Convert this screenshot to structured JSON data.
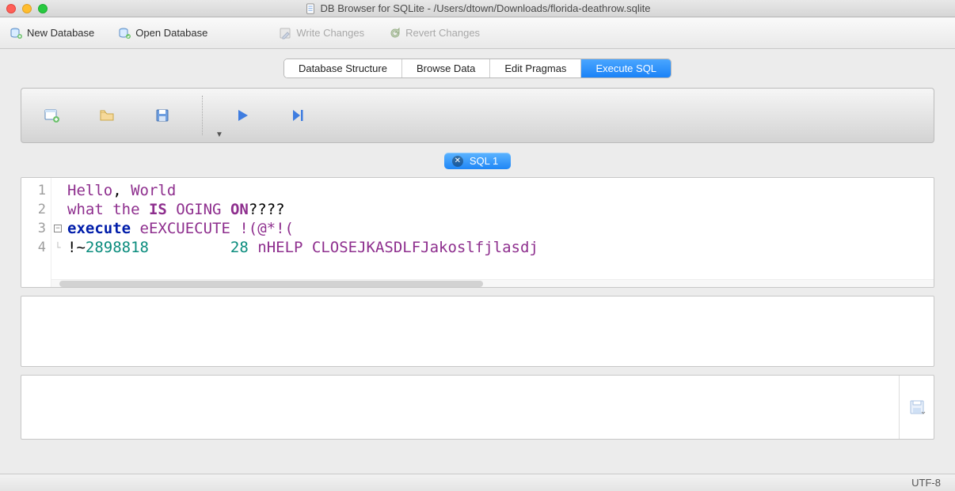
{
  "window": {
    "title": "DB Browser for SQLite - /Users/dtown/Downloads/florida-deathrow.sqlite"
  },
  "toolbar": {
    "new_db": "New Database",
    "open_db": "Open Database",
    "write_changes": "Write Changes",
    "revert_changes": "Revert Changes"
  },
  "tabs": {
    "items": [
      "Database Structure",
      "Browse Data",
      "Edit Pragmas",
      "Execute SQL"
    ],
    "active_index": 3
  },
  "sql_tabs": {
    "active": "SQL 1"
  },
  "editor": {
    "lines": [
      {
        "n": "1",
        "segments": [
          {
            "t": "Hello",
            "c": "ident"
          },
          {
            "t": ", ",
            "c": "plain"
          },
          {
            "t": "World",
            "c": "ident"
          }
        ]
      },
      {
        "n": "2",
        "segments": [
          {
            "t": "what the ",
            "c": "ident"
          },
          {
            "t": "IS",
            "c": "kw2"
          },
          {
            "t": " ",
            "c": "plain"
          },
          {
            "t": "OGING",
            "c": "ident"
          },
          {
            "t": " ",
            "c": "plain"
          },
          {
            "t": "ON",
            "c": "kw2"
          },
          {
            "t": "????",
            "c": "plain"
          }
        ]
      },
      {
        "n": "3",
        "fold": true,
        "segments": [
          {
            "t": "execute",
            "c": "kw"
          },
          {
            "t": " eEXCUECUTE !(@*!(",
            "c": "ident"
          }
        ]
      },
      {
        "n": "4",
        "guide": true,
        "segments": [
          {
            "t": "!~",
            "c": "plain"
          },
          {
            "t": "2898818",
            "c": "num"
          },
          {
            "t": "         ",
            "c": "plain"
          },
          {
            "t": "28",
            "c": "num"
          },
          {
            "t": " nHELP CLOSEJKASDLFJakoslfjlasdj",
            "c": "ident"
          }
        ]
      }
    ]
  },
  "status": {
    "encoding": "UTF-8"
  },
  "icons": {
    "db": "db-icon",
    "new": "new-db-icon",
    "open": "open-db-icon",
    "write": "write-icon",
    "revert": "revert-icon",
    "newtab": "new-sql-tab-icon",
    "opensql": "open-sql-icon",
    "savesql": "save-sql-icon",
    "run": "run-icon",
    "runline": "run-line-icon",
    "save_result": "save-result-icon"
  }
}
